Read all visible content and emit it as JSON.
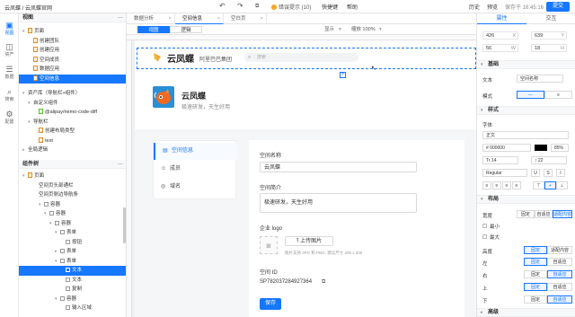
{
  "topbar": {
    "breadcrumb": "云凤蝶 / 云凤蝶官网",
    "status": "错误提示 (10)",
    "shortcuts": "快捷键",
    "help": "帮助",
    "history": "历史",
    "preview": "预览",
    "save_time": "保存于 16:45:16",
    "publish": "提交"
  },
  "leftrail": {
    "items": [
      {
        "label": "视图",
        "icon": "view-icon"
      },
      {
        "label": "资产",
        "icon": "asset-icon"
      },
      {
        "label": "数据",
        "icon": "data-icon"
      },
      {
        "label": "搜索",
        "icon": "search-icon"
      },
      {
        "label": "配置",
        "icon": "config-icon"
      }
    ]
  },
  "view_panel": {
    "title": "视图",
    "rows": [
      "页面",
      "创建团队",
      "创建应用",
      "空间成员",
      "数据应用",
      "空间信息"
    ]
  },
  "asset_panel": {
    "title": "资产库（导航栏+组件）",
    "rows": [
      "自定义组件",
      "@alipay/nemo-code-diff",
      "导航栏",
      "创建布局类型",
      "test",
      "全局逻辑"
    ]
  },
  "component_tree": {
    "title": "组件树",
    "rows": [
      "页面",
      "空间页头部通栏",
      "空间页侧边导航条",
      "容器",
      "容器",
      "容器",
      "表单",
      "按钮",
      "表单",
      "表单",
      "文本",
      "文本",
      "复制",
      "容器",
      "输入区域"
    ]
  },
  "tabs": [
    "数据分析",
    "空间信息",
    "空白页"
  ],
  "toolbar": {
    "view_mode": "视图",
    "logic_mode": "逻辑",
    "display": "显示",
    "zoom": "缩放 100%"
  },
  "canvas": {
    "brand": "云凤蝶",
    "brand_sub": "阿里巴巴集团",
    "search_placeholder": "搜索",
    "app_title": "云凤蝶",
    "app_subtitle": "极速研发，天生好用",
    "nav": [
      "空间信息",
      "成员",
      "域名"
    ],
    "form": {
      "name_label": "空间名称",
      "name_value": "云凤蝶",
      "desc_label": "空间简介",
      "desc_value": "极速研发，天生好用",
      "logo_label": "企业 logo",
      "upload_button": "上传图片",
      "upload_hint": "图片支持 JPG 和 PNG, 建议尺寸 200 x 200",
      "id_label": "空间 ID",
      "id_value": "SP782037284927364",
      "save_button": "保存"
    }
  },
  "rpanel": {
    "tab_props": "属性",
    "tab_interact": "交互",
    "x": "426",
    "y": "639",
    "w": "56",
    "h": "18",
    "sec_basic": "基础",
    "text_label": "文本",
    "text_value": "空间名称",
    "mode_label": "模式",
    "sec_style": "样式",
    "font_label": "字体",
    "font_style": "正文",
    "color_hex": "# 000000",
    "color_alpha": "85%",
    "font_size": "14",
    "line_height": "22",
    "weight": "Regular",
    "sec_layout": "布局",
    "width_label": "宽度",
    "min_label": "最小",
    "max_label": "最大",
    "height_label": "高度",
    "left_label": "左",
    "right_label": "右",
    "top_label": "上",
    "bottom_label": "下",
    "fixed": "固定",
    "adaptive": "自适应",
    "fit_content": "适配内容",
    "sec_advanced": "高级",
    "accent": "#1677ff"
  }
}
